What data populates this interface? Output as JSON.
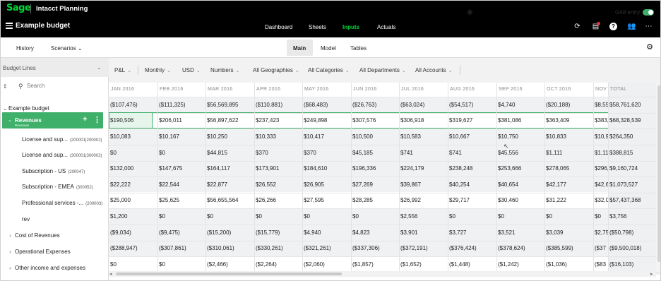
{
  "app": {
    "logo": "Sage",
    "title": "Intacct Planning"
  },
  "budget": {
    "title": "Example budget"
  },
  "top_nav": [
    "Dashboard",
    "Sheets",
    "Inputs",
    "Actuals"
  ],
  "top_nav_active": "Inputs",
  "top_icons": [
    "refresh-icon",
    "clipboard-icon",
    "help-icon",
    "users-icon",
    "more-icon"
  ],
  "subbar": {
    "history": "History",
    "scenarios": "Scenarios",
    "tabs": [
      "Main",
      "Model",
      "Tables"
    ],
    "active_tab": "Main"
  },
  "left_panel": {
    "header": "Budget Lines",
    "search_placeholder": "Search",
    "root": "Example budget",
    "selected": {
      "label": "Revenues",
      "sub": "Revenues"
    },
    "children": [
      {
        "label": "License and sup...",
        "code": "(200001|200002)"
      },
      {
        "label": "License and sup...",
        "code": "(300001|300002)"
      },
      {
        "label": "Subscription - US",
        "code": "(200047)"
      },
      {
        "label": "Subscription - EMEA",
        "code": "(300052)"
      },
      {
        "label": "Professional services -...",
        "code": "(200003)"
      },
      {
        "label": "rev",
        "code": ""
      }
    ],
    "groups": [
      "Cost of Revenues",
      "Operational Expenses",
      "Other income and expenses"
    ]
  },
  "filters": {
    "items": [
      "P&L",
      "Monthly",
      "USD",
      "Numbers",
      "All Geographies",
      "All Categories",
      "All Departments",
      "All Accounts"
    ],
    "grid_entry": "Grid entry",
    "grid_entry_on": true
  },
  "grid": {
    "columns": [
      "JAN 2016",
      "FEB 2016",
      "MAR 2016",
      "APR 2016",
      "MAY 2016",
      "JUN 2016",
      "JUL 2016",
      "AUG 2016",
      "SEP 2016",
      "OCT 2016",
      "NOV",
      "TOTAL"
    ],
    "rows": [
      [
        "($107,476)",
        "($111,325)",
        "$56,569,895",
        "($110,881)",
        "($68,483)",
        "($26,763)",
        "($63,024)",
        "($54,517)",
        "$4,740",
        "($20,188)",
        "$8,55",
        "$58,761,620"
      ],
      [
        "$190,506",
        "$206,011",
        "$56,897,622",
        "$237,423",
        "$249,898",
        "$307,576",
        "$306,918",
        "$319,627",
        "$381,086",
        "$363,409",
        "$383,",
        "$68,328,539"
      ],
      [
        "$10,083",
        "$10,167",
        "$10,250",
        "$10,333",
        "$10,417",
        "$10,500",
        "$10,583",
        "$10,667",
        "$10,750",
        "$10,833",
        "$10,9",
        "$264,350"
      ],
      [
        "$0",
        "$0",
        "$44,815",
        "$370",
        "$370",
        "$45,185",
        "$741",
        "$741",
        "$45,556",
        "$1,111",
        "$1,11",
        "$388,815"
      ],
      [
        "$132,000",
        "$147,675",
        "$164,117",
        "$173,901",
        "$184,610",
        "$196,336",
        "$224,179",
        "$238,248",
        "$253,666",
        "$278,065",
        "$296,",
        "$9,160,724"
      ],
      [
        "$22,222",
        "$22,544",
        "$22,877",
        "$26,552",
        "$26,905",
        "$27,269",
        "$39,867",
        "$40,254",
        "$40,654",
        "$42,177",
        "$42,6",
        "$1,073,527"
      ],
      [
        "$25,000",
        "$25,625",
        "$56,655,564",
        "$26,266",
        "$27,595",
        "$28,285",
        "$26,992",
        "$29,717",
        "$30,460",
        "$31,222",
        "$32,0",
        "$57,437,368"
      ],
      [
        "$1,200",
        "$0",
        "$0",
        "$0",
        "$0",
        "$0",
        "$2,556",
        "$0",
        "$0",
        "$0",
        "$0",
        "$3,756"
      ],
      [
        "($9,034)",
        "($9,475)",
        "($15,200)",
        "($15,779)",
        "$4,940",
        "$4,823",
        "$3,901",
        "$3,727",
        "$3,521",
        "$3,039",
        "$2,75",
        "($50,798)"
      ],
      [
        "($288,947)",
        "($307,861)",
        "($310,061)",
        "($330,261)",
        "($321,261)",
        "($337,306)",
        "($372,191)",
        "($376,424)",
        "($378,624)",
        "($385,599)",
        "($37",
        "($9,500,018)"
      ],
      [
        "$0",
        "$0",
        "($2,466)",
        "($2,264)",
        "($2,060)",
        "($1,857)",
        "($1,652)",
        "($1,448)",
        "($1,242)",
        "($1,036)",
        "($83",
        "($16,103)"
      ]
    ]
  },
  "colors": {
    "accent": "#00d639",
    "selected_row": "#3fb06a",
    "topbar": "#000000"
  }
}
